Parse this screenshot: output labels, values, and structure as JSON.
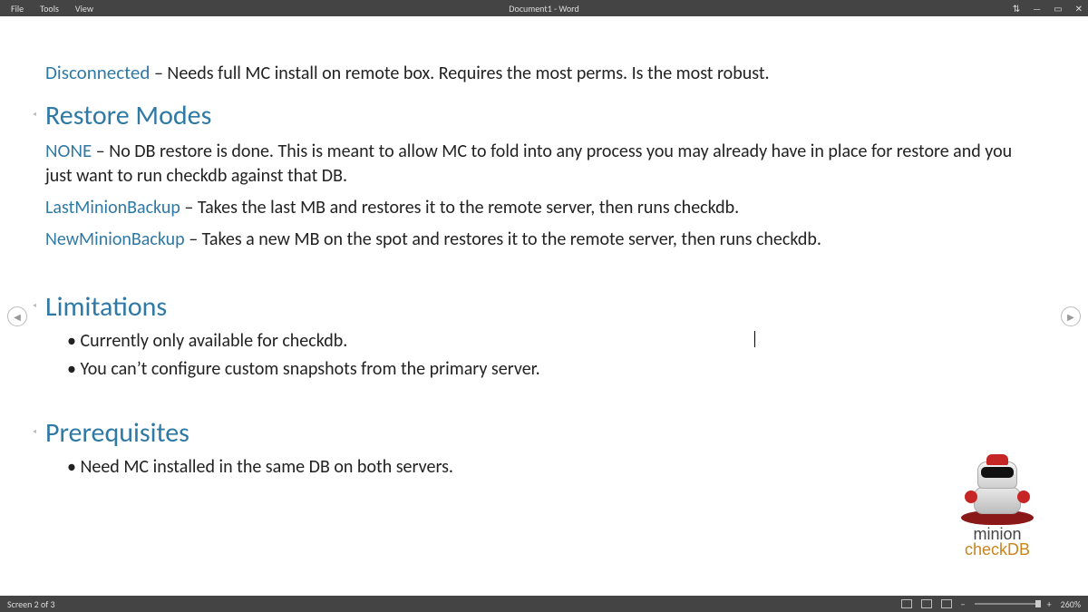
{
  "app": {
    "title": "Document1 - Word",
    "menus": [
      "File",
      "Tools",
      "View"
    ]
  },
  "window_buttons": {
    "share": "⇅",
    "min": "—",
    "max": "▭",
    "close": "✕"
  },
  "nav": {
    "prev": "◀",
    "next": "▶"
  },
  "doc": {
    "disconnected": {
      "term": "Disconnected",
      "desc": " – Needs full MC install on remote box.  Requires the most perms. Is the most robust."
    },
    "restore_heading": "Restore Modes",
    "modes": {
      "none": {
        "term": "NONE",
        "desc": " – No DB restore is done.  This is meant to allow MC to fold into any process you may already have in place for restore and you just want to run checkdb against that DB."
      },
      "last": {
        "term": "LastMinionBackup",
        "desc": " – Takes the last MB and restores it to the remote server, then runs checkdb."
      },
      "new": {
        "term": "NewMinionBackup",
        "desc": " – Takes a new MB on the spot and restores it to the remote server, then runs checkdb."
      }
    },
    "limitations_heading": "Limitations",
    "limitations": [
      "Currently only available for checkdb.",
      "You can’t configure custom snapshots from the primary server."
    ],
    "prereq_heading": "Prerequisites",
    "prereq": [
      "Need MC installed in the same DB on both servers."
    ]
  },
  "status": {
    "left": "Screen 2 of 3",
    "zoom": "260%",
    "plus": "+",
    "minus": "−"
  },
  "logo": {
    "brand": "minion",
    "product": "checkDB"
  }
}
